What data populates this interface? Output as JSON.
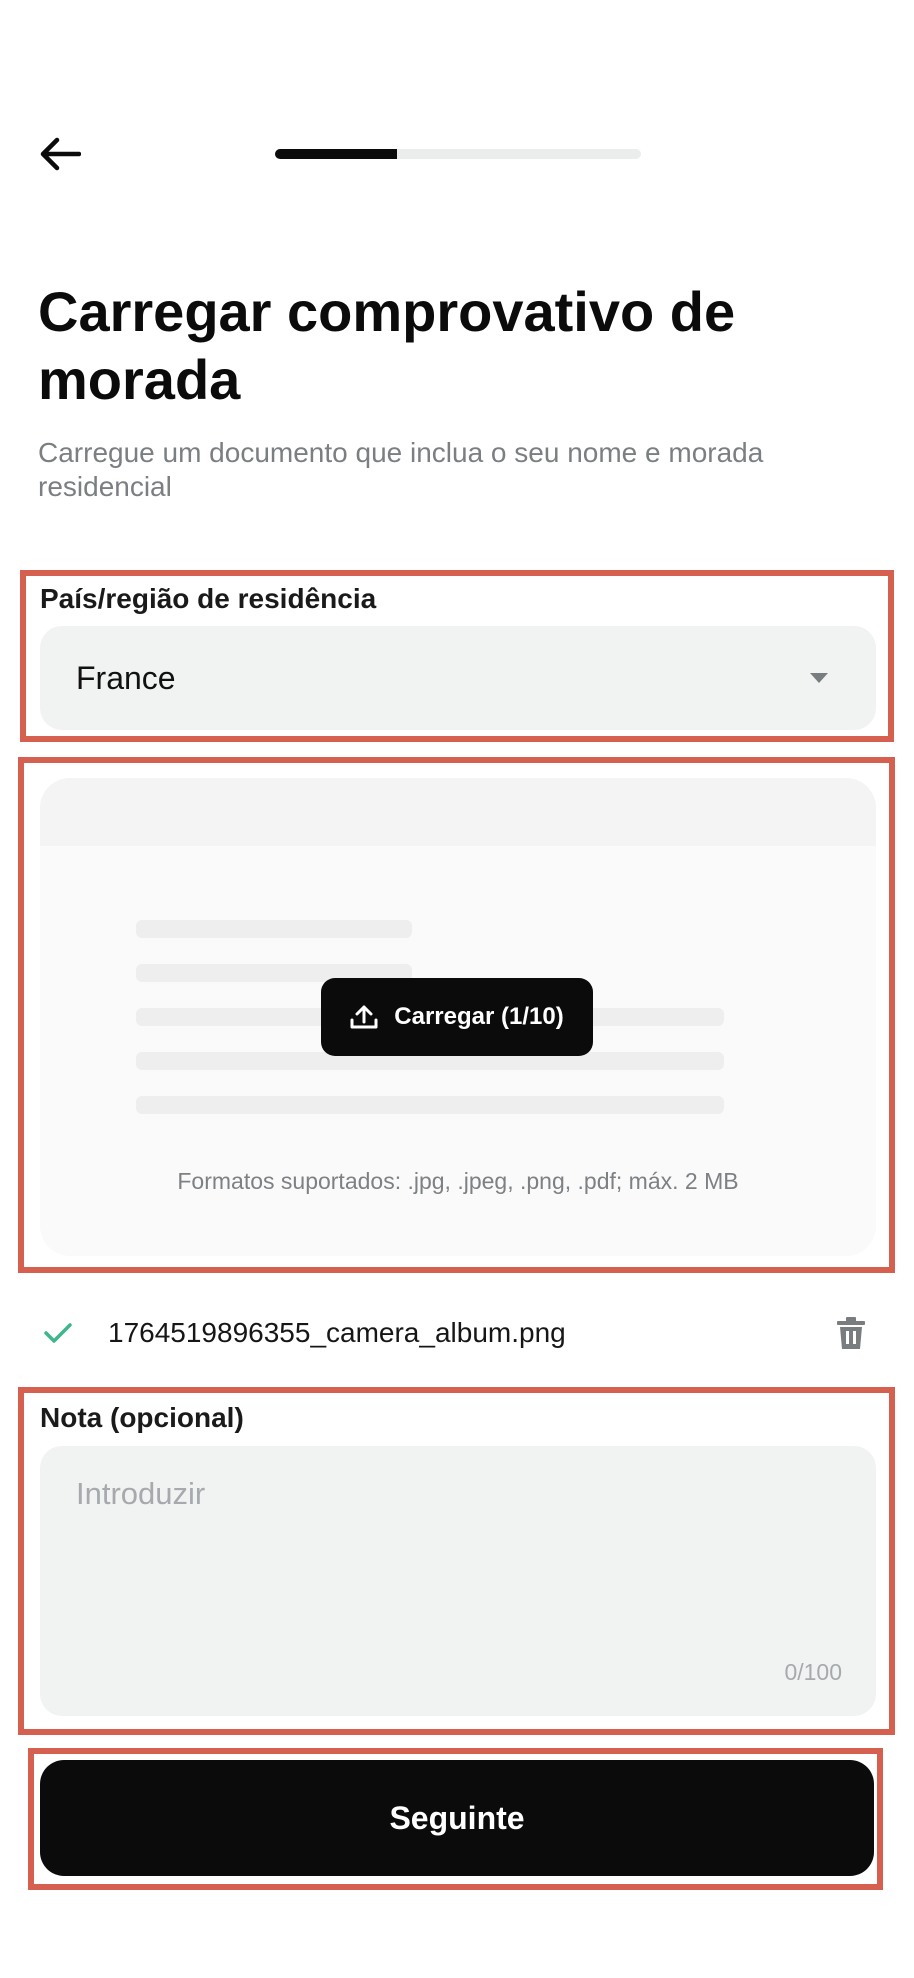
{
  "header": {
    "back_icon": "arrow-left-icon",
    "progress": {
      "current_step": 1,
      "total_steps": 3,
      "fraction": 0.333
    }
  },
  "page": {
    "title": "Carregar comprovativo de morada",
    "subtitle": "Carregue um documento que inclua o seu nome e morada residencial"
  },
  "country": {
    "label": "País/região de residência",
    "value": "France",
    "icon": "caret-down-icon"
  },
  "upload": {
    "button_label": "Carregar (1/10)",
    "button_icon": "upload-icon",
    "formats": "Formatos suportados: .jpg, .jpeg, .png, .pdf; máx. 2 MB"
  },
  "uploaded_file": {
    "name": "1764519896355_camera_album.png",
    "status_icon": "check-icon",
    "delete_icon": "trash-icon"
  },
  "note": {
    "label": "Nota (opcional)",
    "placeholder": "Introduzir",
    "value": "",
    "counter": "0/100"
  },
  "next_button": {
    "label": "Seguinte"
  },
  "colors": {
    "primary": "#0b0b0b",
    "highlight_frame": "#d6604f",
    "field_bg": "#f1f3f3",
    "success_check": "#3fb68b",
    "muted_text": "#7b7f82"
  }
}
